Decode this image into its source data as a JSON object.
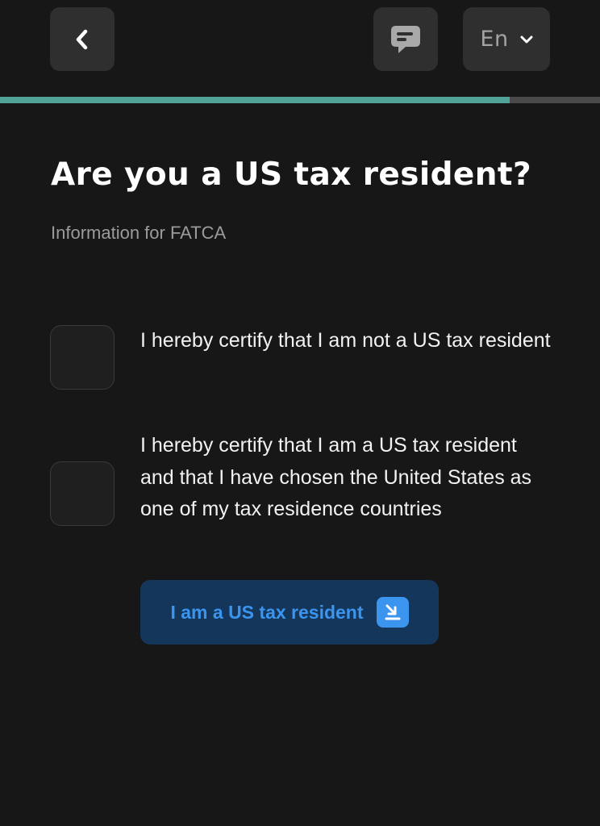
{
  "header": {
    "back_icon": "chevron-left-icon",
    "chat_icon": "chat-bubble-icon",
    "language": "En",
    "language_icon": "chevron-down-icon"
  },
  "progress": {
    "value_percent": 85,
    "fill_color": "#4fa397",
    "track_color": "#4a4a4a"
  },
  "page": {
    "title": "Are you a US tax resident?",
    "subtitle": "Information for FATCA"
  },
  "options": [
    {
      "label": "I hereby certify that I am not a US tax resident",
      "checked": false
    },
    {
      "label": "I hereby certify that I am a US tax resident and that I have chosen the United States as one of my tax residence countries",
      "checked": false
    }
  ],
  "cta": {
    "label": "I am a US tax resident",
    "icon": "download-document-icon",
    "background": "#14365a",
    "text_color": "#3b95ef"
  },
  "colors": {
    "background": "#171717",
    "button_surface": "#2f2f2f",
    "accent": "#4fa397"
  }
}
